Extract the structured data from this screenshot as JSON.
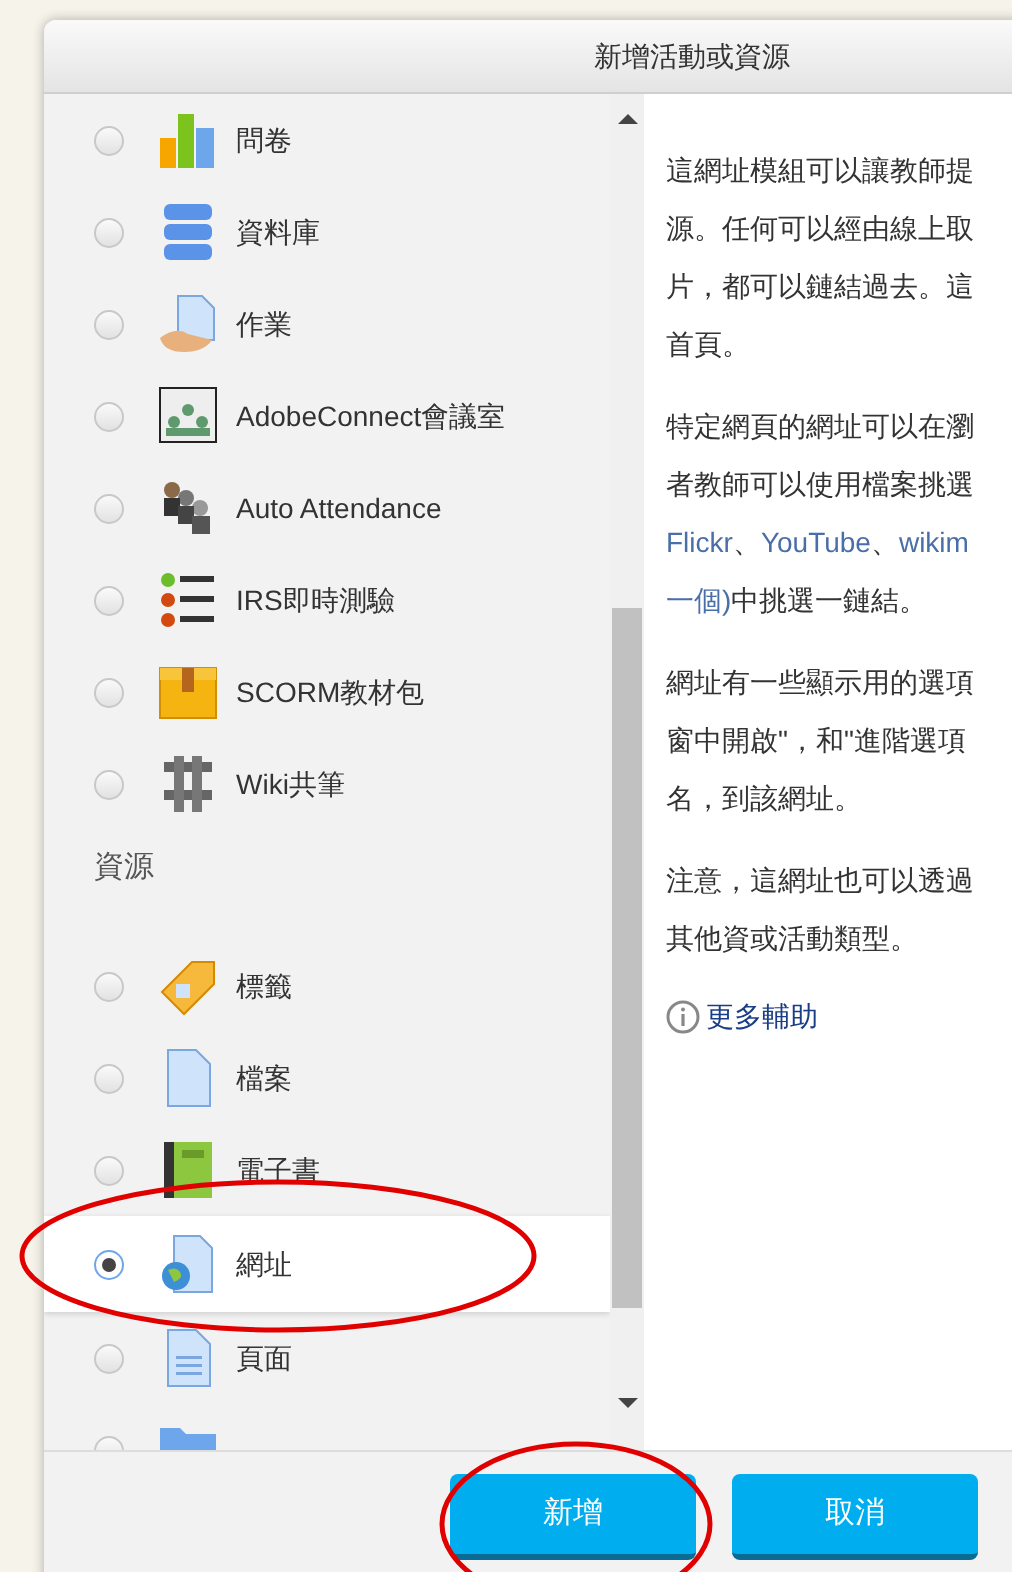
{
  "dialog": {
    "title": "新增活動或資源"
  },
  "sections": [
    {
      "items": [
        {
          "label": "問卷",
          "selected": false,
          "circled": false
        },
        {
          "label": "資料庫",
          "selected": false,
          "circled": false
        },
        {
          "label": "作業",
          "selected": false,
          "circled": false
        },
        {
          "label": "AdobeConnect會議室",
          "selected": false,
          "circled": false
        },
        {
          "label": "Auto Attendance",
          "selected": false,
          "circled": false
        },
        {
          "label": "IRS即時測驗",
          "selected": false,
          "circled": false
        },
        {
          "label": "SCORM教材包",
          "selected": false,
          "circled": false
        },
        {
          "label": "Wiki共筆",
          "selected": false,
          "circled": false
        }
      ]
    },
    {
      "heading": "資源",
      "items": [
        {
          "label": "標籤",
          "selected": false,
          "circled": false
        },
        {
          "label": "檔案",
          "selected": false,
          "circled": false
        },
        {
          "label": "電子書",
          "selected": false,
          "circled": false
        },
        {
          "label": "網址",
          "selected": true,
          "circled": true
        },
        {
          "label": "頁面",
          "selected": false,
          "circled": false
        },
        {
          "selected": false,
          "circled": false
        }
      ]
    }
  ],
  "description": {
    "paragraphs": [
      {
        "lines": [
          [
            {
              "text": "這網址模組可以讓教師提"
            }
          ],
          [
            {
              "text": "源。任何可以經由線上取"
            }
          ],
          [
            {
              "text": "片，都可以鏈結過去。這"
            }
          ],
          [
            {
              "text": "首頁。"
            }
          ]
        ]
      },
      {
        "lines": [
          [
            {
              "text": "特定網頁的網址可以在瀏"
            }
          ],
          [
            {
              "text": "者教師可以使用檔案挑選"
            }
          ],
          [
            {
              "text": "Flickr",
              "link": true
            },
            {
              "text": "、",
              "link": false
            },
            {
              "text": "YouTube",
              "link": true
            },
            {
              "text": "、",
              "link": false
            },
            {
              "text": "wikim",
              "link": true
            }
          ],
          [
            {
              "text": "一個)",
              "link": true
            },
            {
              "text": "中挑選一鏈結。",
              "link": false
            }
          ]
        ]
      },
      {
        "lines": [
          [
            {
              "text": "網址有一些顯示用的選項"
            }
          ],
          [
            {
              "text": "窗中開啟\"，和\"進階選項"
            }
          ],
          [
            {
              "text": "名，到該網址。"
            }
          ]
        ]
      },
      {
        "lines": [
          [
            {
              "text": "注意，這網址也可以透過"
            }
          ],
          [
            {
              "text": "其他資或活動類型。"
            }
          ]
        ]
      }
    ],
    "help_link": "更多輔助"
  },
  "buttons": [
    {
      "label": "新增",
      "circled": true
    },
    {
      "label": "取消",
      "circled": false
    }
  ]
}
